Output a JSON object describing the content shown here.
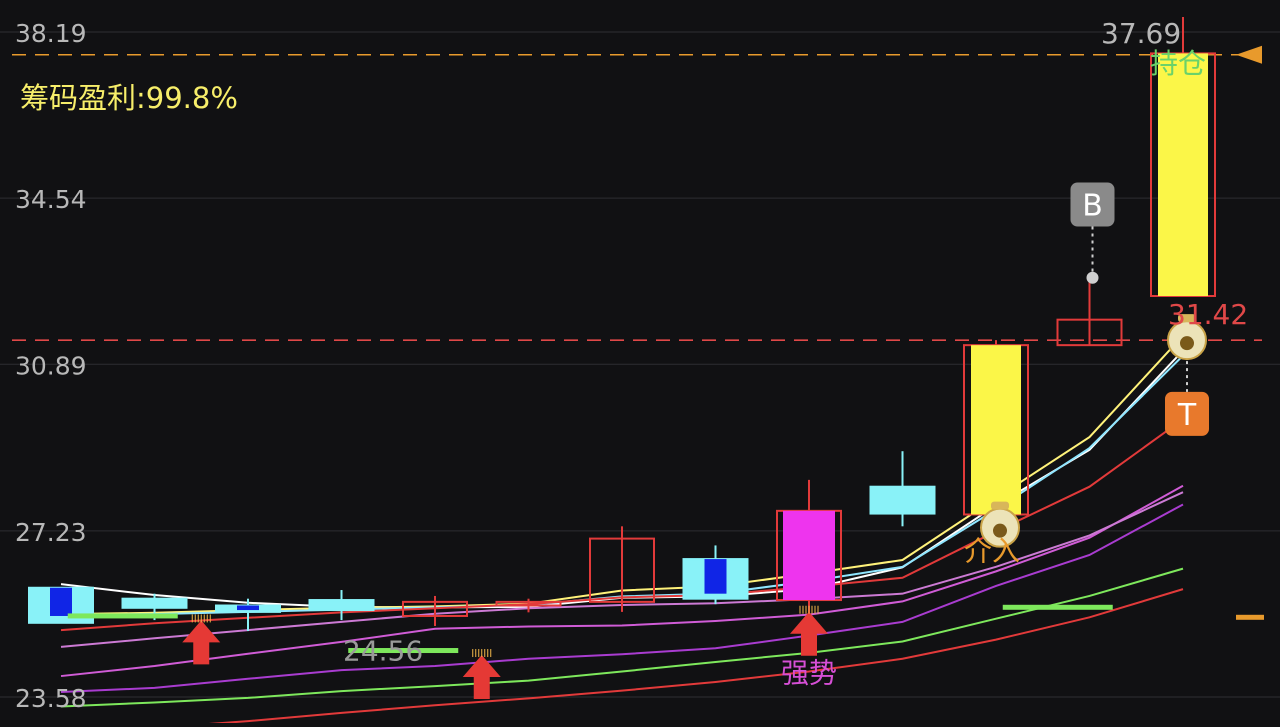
{
  "chart_data": {
    "type": "candlestick",
    "y_axis": {
      "ticks": [
        38.19,
        34.54,
        30.89,
        27.23,
        23.58
      ],
      "tick_labels": [
        "38.19",
        "34.54",
        "30.89",
        "27.23",
        "23.58"
      ],
      "ylim": [
        23.58,
        38.19
      ],
      "grid": true
    },
    "info_label": "筹码盈利:99.8%",
    "reference_lines": [
      {
        "value": 37.69,
        "label": "37.69",
        "color": "#e89a2c"
      },
      {
        "value": 31.42,
        "label": "31.42",
        "color": "#e04848"
      }
    ],
    "candles": [
      {
        "o": 25.21,
        "c": 25.98,
        "h": 25.98,
        "l": 25.21,
        "style": "cyan",
        "inner": [
          25.36,
          25.98
        ]
      },
      {
        "o": 25.54,
        "c": 25.74,
        "h": 25.85,
        "l": 25.27,
        "style": "cyan"
      },
      {
        "o": 25.45,
        "c": 25.59,
        "h": 25.74,
        "l": 25.03,
        "style": "cyan",
        "inner": [
          25.49,
          25.59
        ]
      },
      {
        "o": 25.49,
        "c": 25.71,
        "h": 25.93,
        "l": 25.27,
        "style": "cyan"
      },
      {
        "o": 25.36,
        "c": 25.67,
        "h": 25.8,
        "l": 25.14,
        "style": "red_hollow"
      },
      {
        "o": 25.59,
        "c": 25.67,
        "h": 25.74,
        "l": 25.44,
        "style": "red_hollow"
      },
      {
        "o": 25.67,
        "c": 27.06,
        "h": 27.33,
        "l": 25.45,
        "style": "red_hollow"
      },
      {
        "o": 25.74,
        "c": 26.61,
        "h": 26.91,
        "l": 25.62,
        "style": "cyan",
        "inner": [
          25.85,
          26.61
        ]
      },
      {
        "o": 25.71,
        "c": 27.67,
        "h": 28.35,
        "l": 24.96,
        "style": "magenta"
      },
      {
        "o": 27.61,
        "c": 28.2,
        "h": 28.98,
        "l": 27.33,
        "style": "cyan"
      },
      {
        "o": 27.59,
        "c": 31.31,
        "h": 31.42,
        "l": 27.59,
        "style": "yellow"
      },
      {
        "o": 31.31,
        "c": 31.87,
        "h": 32.79,
        "l": 31.31,
        "style": "red_hollow"
      },
      {
        "o": 32.39,
        "c": 37.72,
        "h": 38.52,
        "l": 32.39,
        "style": "yellow"
      }
    ],
    "lines": [
      {
        "color": "#ffffff",
        "values": [
          26.06,
          25.82,
          25.65,
          25.56,
          25.55,
          25.56,
          25.76,
          25.79,
          25.95,
          26.43,
          27.79,
          29.01,
          31.19
        ]
      },
      {
        "color": "#fff27a",
        "values": [
          25.4,
          25.43,
          25.49,
          25.54,
          25.57,
          25.63,
          25.92,
          26.01,
          26.29,
          26.59,
          27.95,
          29.29,
          31.52
        ]
      },
      {
        "color": "#8fe6ff",
        "values": [
          25.38,
          25.4,
          25.45,
          25.5,
          25.55,
          25.6,
          25.79,
          25.85,
          26.12,
          26.44,
          27.7,
          29.05,
          31.08
        ]
      },
      {
        "color": "#e23a3a",
        "values": [
          25.05,
          25.2,
          25.32,
          25.44,
          25.53,
          25.62,
          25.77,
          25.82,
          26.0,
          26.2,
          27.22,
          28.2,
          29.68
        ]
      },
      {
        "color": "#d05cd6",
        "values": [
          24.04,
          24.26,
          24.53,
          24.79,
          25.08,
          25.13,
          25.15,
          25.25,
          25.39,
          25.68,
          26.34,
          27.08,
          28.22
        ]
      },
      {
        "color": "#cc7ad4",
        "values": [
          24.68,
          24.87,
          25.05,
          25.23,
          25.41,
          25.53,
          25.6,
          25.64,
          25.73,
          25.85,
          26.44,
          27.13,
          28.08
        ]
      },
      {
        "color": "#a93cd0",
        "values": [
          23.69,
          23.78,
          23.98,
          24.17,
          24.26,
          24.42,
          24.52,
          24.65,
          24.93,
          25.23,
          26.02,
          26.7,
          27.81
        ]
      },
      {
        "color": "#7ee85c",
        "values": [
          23.37,
          23.46,
          23.56,
          23.71,
          23.82,
          23.94,
          24.14,
          24.35,
          24.55,
          24.8,
          25.3,
          25.8,
          26.4
        ]
      },
      {
        "color": "#e23a3a",
        "values": [
          22.75,
          22.9,
          23.05,
          23.23,
          23.4,
          23.55,
          23.72,
          23.91,
          24.14,
          24.42,
          24.84,
          25.33,
          25.95
        ]
      }
    ],
    "support_bars": [
      {
        "candle": 1,
        "value": 25.35
      },
      {
        "candle": 4,
        "value": 24.59
      },
      {
        "candle": 11,
        "value": 25.54
      }
    ],
    "arrows": [
      {
        "candle": 2,
        "value": 25.35,
        "color": "#e53935"
      },
      {
        "candle": 5,
        "value": 24.59,
        "color": "#e53935"
      },
      {
        "candle": 12,
        "value": 25.54,
        "color": "#e53935"
      }
    ],
    "annotations": [
      {
        "text": "24.56",
        "candle": 5,
        "value": 24.56,
        "color": "#9a9a9a"
      },
      {
        "text": "强势",
        "candle": 8,
        "value": 23.9,
        "color": "#d64fd6"
      },
      {
        "text": "介入",
        "candle": 10,
        "value": 27.0,
        "color": "#e89a2c"
      },
      {
        "text": "持仓",
        "candle": 12,
        "value": 37.6,
        "color": "#6ad26a"
      }
    ],
    "signals": [
      {
        "text": "B",
        "candle": 11,
        "value": 34.4,
        "color": "#8a8a8a",
        "dot_value": 32.79
      },
      {
        "text": "T",
        "candle": 12,
        "value": 29.8,
        "color": "#e8792c",
        "dot_value": 31.42
      }
    ],
    "moneybags": [
      {
        "candle": 10,
        "value": 27.3
      },
      {
        "candle": 12,
        "value": 31.42
      }
    ]
  }
}
